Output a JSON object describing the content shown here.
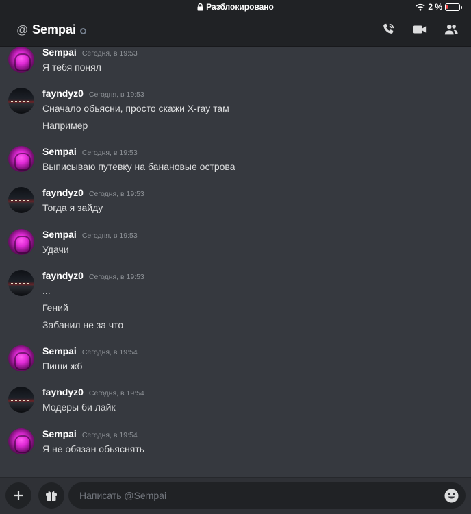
{
  "status_bar": {
    "lock_text": "Разблокировано",
    "battery": "2 %"
  },
  "header": {
    "at_symbol": "@",
    "title": "Sempai"
  },
  "messages": [
    {
      "author": "Sempai",
      "avatar": "sempai",
      "timestamp": "Сегодня, в 19:53",
      "lines": [
        "Я тебя понял"
      ]
    },
    {
      "author": "fayndyz0",
      "avatar": "fayn",
      "timestamp": "Сегодня, в 19:53",
      "lines": [
        "Сначало обьясни, просто скажи X-ray там",
        "Например"
      ]
    },
    {
      "author": "Sempai",
      "avatar": "sempai",
      "timestamp": "Сегодня, в 19:53",
      "lines": [
        "Выписываю путевку на банановые острова"
      ]
    },
    {
      "author": "fayndyz0",
      "avatar": "fayn",
      "timestamp": "Сегодня, в 19:53",
      "lines": [
        "Тогда я зайду"
      ]
    },
    {
      "author": "Sempai",
      "avatar": "sempai",
      "timestamp": "Сегодня, в 19:53",
      "lines": [
        "Удачи"
      ]
    },
    {
      "author": "fayndyz0",
      "avatar": "fayn",
      "timestamp": "Сегодня, в 19:53",
      "lines": [
        "...",
        "Гений",
        "Забанил не за что"
      ]
    },
    {
      "author": "Sempai",
      "avatar": "sempai",
      "timestamp": "Сегодня, в 19:54",
      "lines": [
        "Пиши жб"
      ]
    },
    {
      "author": "fayndyz0",
      "avatar": "fayn",
      "timestamp": "Сегодня, в 19:54",
      "lines": [
        "Модеры би лайк"
      ]
    },
    {
      "author": "Sempai",
      "avatar": "sempai",
      "timestamp": "Сегодня, в 19:54",
      "lines": [
        "Я не обязан обьяснять"
      ]
    }
  ],
  "composer": {
    "placeholder": "Написать @Sempai"
  }
}
